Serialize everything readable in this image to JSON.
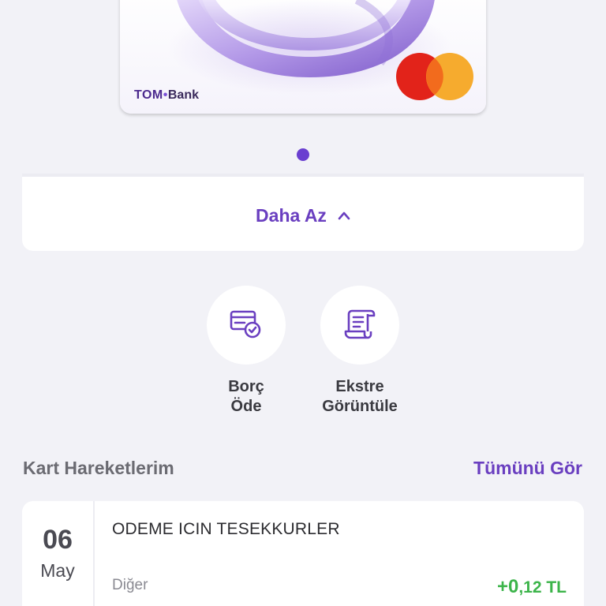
{
  "card": {
    "bank_name_tom": "TOM",
    "bank_name_bank": "Bank",
    "network_icon": "mastercard-logo"
  },
  "toggle": {
    "label": "Daha Az",
    "icon": "chevron-up-icon"
  },
  "actions": [
    {
      "line1": "Borç",
      "line2": "Öde",
      "icon": "card-check-icon"
    },
    {
      "line1": "Ekstre",
      "line2": "Görüntüle",
      "icon": "receipt-scroll-icon"
    }
  ],
  "transactions_section": {
    "title": "Kart Hareketlerim",
    "see_all": "Tümünü Gör"
  },
  "transactions": [
    {
      "day": "06",
      "month": "May",
      "description": "ODEME ICIN TESEKKURLER",
      "category": "Diğer",
      "amount_int": "+0",
      "amount_dec": ",12 TL"
    }
  ],
  "colors": {
    "accent": "#6a3fc0",
    "positive": "#3cb44a",
    "background": "#f2f2f7"
  }
}
